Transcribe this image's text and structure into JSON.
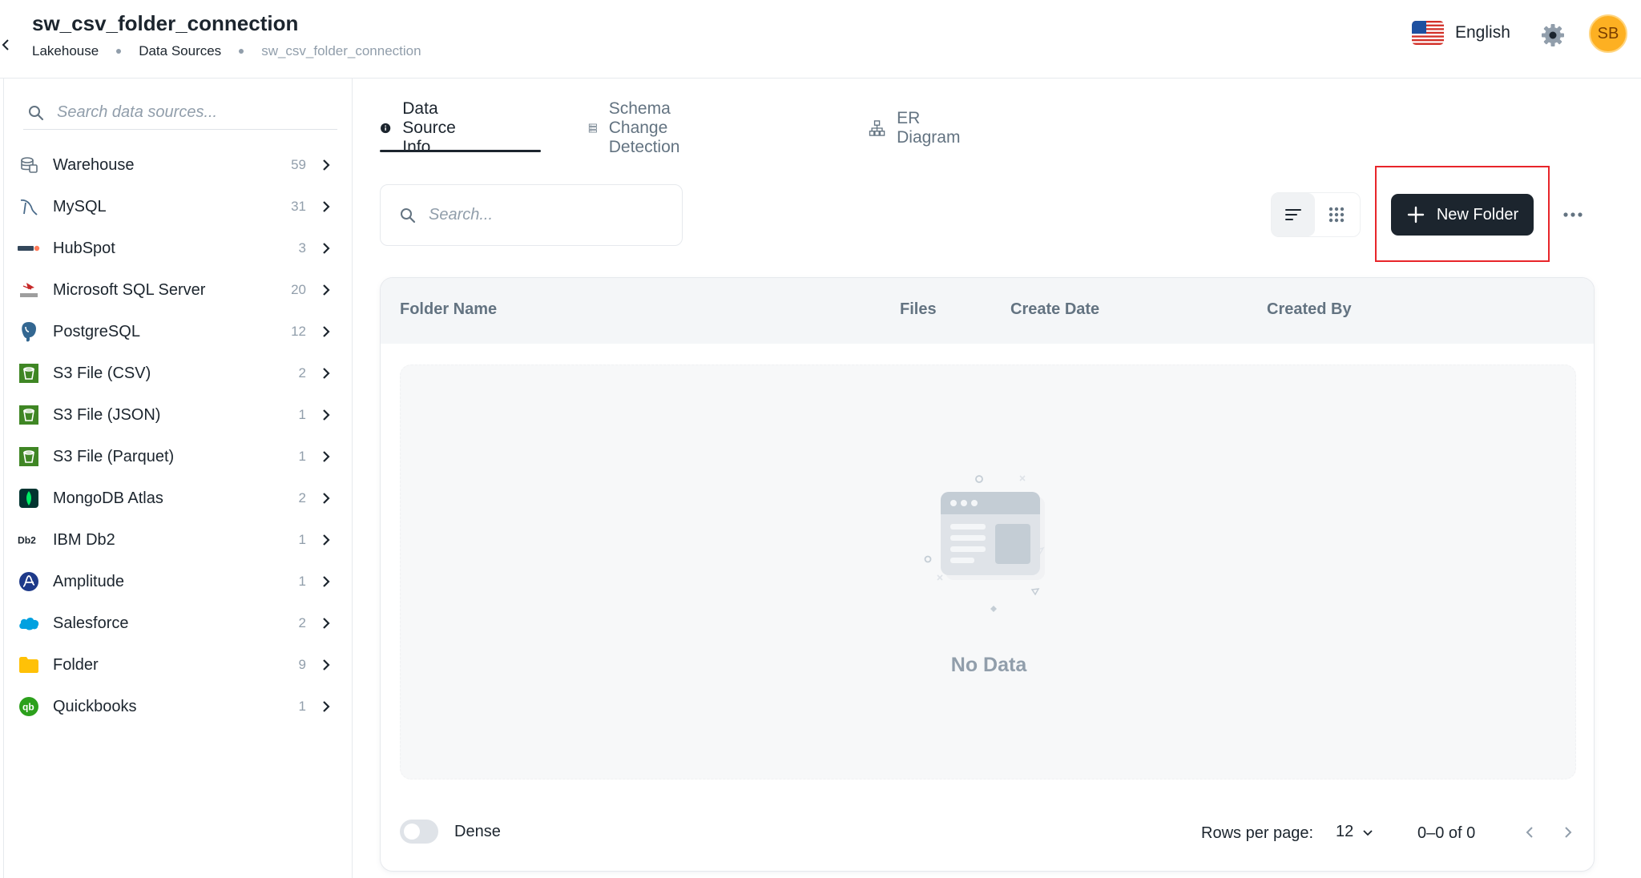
{
  "header": {
    "title": "sw_csv_folder_connection",
    "breadcrumbs": [
      "Lakehouse",
      "Data Sources",
      "sw_csv_folder_connection"
    ],
    "language": "English",
    "avatar_initials": "SB",
    "avatar_color": "#fdb022"
  },
  "sidebar": {
    "search_placeholder": "Search data sources...",
    "items": [
      {
        "label": "Warehouse",
        "count": "59",
        "icon": "warehouse-icon"
      },
      {
        "label": "MySQL",
        "count": "31",
        "icon": "mysql-icon"
      },
      {
        "label": "HubSpot",
        "count": "3",
        "icon": "hubspot-icon"
      },
      {
        "label": "Microsoft SQL Server",
        "count": "20",
        "icon": "sql-server-icon"
      },
      {
        "label": "PostgreSQL",
        "count": "12",
        "icon": "postgresql-icon"
      },
      {
        "label": "S3 File (CSV)",
        "count": "2",
        "icon": "s3-bucket-icon"
      },
      {
        "label": "S3 File (JSON)",
        "count": "1",
        "icon": "s3-bucket-icon"
      },
      {
        "label": "S3 File (Parquet)",
        "count": "1",
        "icon": "s3-bucket-icon"
      },
      {
        "label": "MongoDB Atlas",
        "count": "2",
        "icon": "mongodb-icon"
      },
      {
        "label": "IBM Db2",
        "count": "1",
        "icon": "db2-icon"
      },
      {
        "label": "Amplitude",
        "count": "1",
        "icon": "amplitude-icon"
      },
      {
        "label": "Salesforce",
        "count": "2",
        "icon": "salesforce-icon"
      },
      {
        "label": "Folder",
        "count": "9",
        "icon": "folder-icon"
      },
      {
        "label": "Quickbooks",
        "count": "1",
        "icon": "quickbooks-icon"
      }
    ]
  },
  "tabs": [
    {
      "label": "Data Source Info",
      "icon": "info-icon",
      "active": true
    },
    {
      "label": "Schema Change Detection",
      "icon": "schema-icon",
      "active": false
    },
    {
      "label": "ER Diagram",
      "icon": "hierarchy-icon",
      "active": false
    }
  ],
  "toolbar": {
    "search_placeholder": "Search...",
    "new_folder_label": "New Folder"
  },
  "table": {
    "columns": [
      "Folder Name",
      "Files",
      "Create Date",
      "Created By"
    ],
    "empty_text": "No Data",
    "dense_label": "Dense",
    "rows_per_page_label": "Rows per page:",
    "rows_per_page_value": "12",
    "range_label": "0–0 of 0"
  }
}
